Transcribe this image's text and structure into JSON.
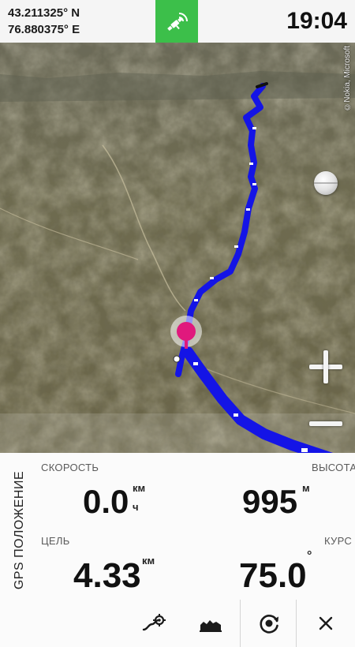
{
  "status_bar": {
    "latitude": "43.211325° N",
    "longitude": "76.880375° E",
    "time": "19:04",
    "gps_icon": "satellite-icon",
    "gps_color": "#3cbf4a"
  },
  "map": {
    "copyright": "©Nokia, Microsoft",
    "track_color": "#1414e6",
    "marker_color": "#e0197d",
    "zoom_in_icon": "plus-icon",
    "zoom_out_icon": "minus-icon",
    "compass_icon": "compass-ball-icon"
  },
  "panel": {
    "title": "GPS ПОЛОЖЕНИЕ",
    "speed": {
      "label": "СКОРОСТЬ",
      "value": "0.0",
      "unit_top": "км",
      "unit_bottom": "ч"
    },
    "altitude": {
      "label": "ВЫСОТА",
      "value": "995",
      "unit": "м"
    },
    "target": {
      "label": "ЦЕЛЬ",
      "value": "4.33",
      "unit": "км"
    },
    "course": {
      "label": "КУРС",
      "value": "75.0",
      "unit": "°"
    }
  },
  "toolbar": {
    "items": [
      "route-target-icon",
      "elevation-profile-icon",
      "recenter-icon",
      "close-icon"
    ]
  }
}
